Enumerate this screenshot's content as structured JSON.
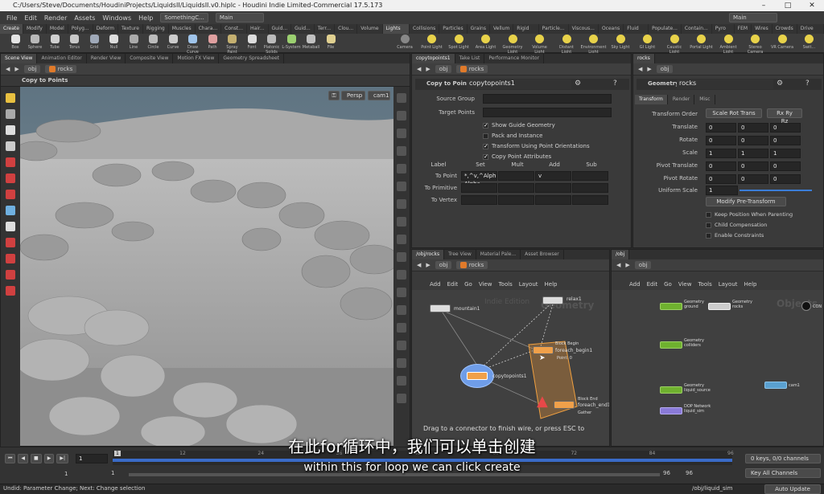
{
  "window": {
    "title": "C:/Users/Steve/Documents/HoudiniProjects/LiquidsII/LiquidsII.v0.hiplc - Houdini Indie Limited-Commercial 17.5.173"
  },
  "menu": {
    "items": [
      "File",
      "Edit",
      "Render",
      "Assets",
      "Windows",
      "Help"
    ],
    "desktop": "SomethingC...",
    "main_left": "Main",
    "main_right": "Main"
  },
  "shelf_tabs_left": [
    "Create",
    "Modify",
    "Model",
    "Polyg...",
    "Deform",
    "Texture",
    "Rigging",
    "Muscles",
    "Chara...",
    "Const...",
    "Hair...",
    "Guid...",
    "Guid...",
    "Terr...",
    "Clou...",
    "Volume"
  ],
  "shelf_tabs_right": [
    "Lights a...",
    "Collisions",
    "Particles",
    "Grains",
    "Vellum",
    "Rigid B...",
    "Particle...",
    "Viscous...",
    "Oceans",
    "Fluid C...",
    "Populate...",
    "Contain...",
    "Pyro FX",
    "FEM",
    "Wires",
    "Crowds",
    "Drive Si..."
  ],
  "shelf_tools_left": [
    "Box",
    "Sphere",
    "Tube",
    "Torus",
    "Grid",
    "Null",
    "Line",
    "Circle",
    "Curve",
    "Draw Curve",
    "Path",
    "Spray Paint",
    "Font",
    "Platonic Solids",
    "L-System",
    "Metaball",
    "File"
  ],
  "shelf_tools_right": [
    "Camera",
    "Point Light",
    "Spot Light",
    "Area Light",
    "Geometry Light",
    "Volume Light",
    "Distant Light",
    "Environment Light",
    "Sky Light",
    "GI Light",
    "Caustic Light",
    "Portal Light",
    "Ambient Light",
    "Stereo Camera",
    "VR Camera",
    "Swit..."
  ],
  "viewport": {
    "tabs": [
      "Scene View",
      "Animation Editor",
      "Render View",
      "Composite View",
      "Motion FX View",
      "Geometry Spreadsheet"
    ],
    "path": [
      "obj",
      "rocks"
    ],
    "node_label": "Copy to Points",
    "persp": "Persp",
    "cam": "cam1"
  },
  "params": {
    "tabs": [
      "copytopoints1",
      "Take List",
      "Performance Monitor"
    ],
    "path": [
      "obj",
      "rocks"
    ],
    "node_type": "Copy to Points",
    "node_name": "copytopoints1",
    "source_group_label": "Source Group",
    "target_points_label": "Target Points",
    "checkboxes": [
      {
        "label": "Show Guide Geometry",
        "checked": true
      },
      {
        "label": "Pack and Instance",
        "checked": false
      },
      {
        "label": "Transform Using Point Orientations",
        "checked": true
      },
      {
        "label": "Copy Point Attributes",
        "checked": true
      }
    ],
    "attr_headers": [
      "Label",
      "Set",
      "Mult",
      "Add",
      "Sub"
    ],
    "attr_rows": [
      {
        "label": "To Point",
        "set": "*,^v,^Alph Alpha",
        "mult": "",
        "add": "v",
        "sub": ""
      },
      {
        "label": "To Primitive",
        "set": "",
        "mult": "",
        "add": "",
        "sub": ""
      },
      {
        "label": "To Vertex",
        "set": "",
        "mult": "",
        "add": "",
        "sub": ""
      }
    ]
  },
  "geo": {
    "tabs": [
      "rocks"
    ],
    "path": [
      "obj"
    ],
    "node_type": "Geometry",
    "node_name": "rocks",
    "subtabs": [
      "Transform",
      "Render",
      "Misc"
    ],
    "transform_order": {
      "label": "Transform Order",
      "value": "Scale Rot Trans",
      "rot": "Rx Ry Rz"
    },
    "rows": [
      {
        "label": "Translate",
        "v": [
          "0",
          "0",
          "0"
        ]
      },
      {
        "label": "Rotate",
        "v": [
          "0",
          "0",
          "0"
        ]
      },
      {
        "label": "Scale",
        "v": [
          "1",
          "1",
          "1"
        ]
      },
      {
        "label": "Pivot Translate",
        "v": [
          "0",
          "0",
          "0"
        ]
      },
      {
        "label": "Pivot Rotate",
        "v": [
          "0",
          "0",
          "0"
        ]
      }
    ],
    "uniform_scale": {
      "label": "Uniform Scale",
      "value": "1"
    },
    "modify_button": "Modify Pre-Transform",
    "options": [
      "Keep Position When Parenting",
      "Child Compensation",
      "Enable Constraints"
    ]
  },
  "network_left": {
    "tabs": [
      "/obj/rocks",
      "Tree View",
      "Material Pale...",
      "Asset Browser"
    ],
    "path": [
      "obj",
      "rocks"
    ],
    "menu": [
      "Add",
      "Edit",
      "Go",
      "View",
      "Tools",
      "Layout",
      "Help"
    ],
    "watermark": "Indie Edition",
    "context": "Geometry",
    "nodes": {
      "mountain": "mountain1",
      "relax": "relax1",
      "block_begin": "Block Begin",
      "foreach_begin": "foreach_begin1",
      "point_label": "Point: 0",
      "copy": "copytopoints1",
      "block_end": "Block End",
      "foreach_end": "foreach_end1",
      "gather": "Gather"
    },
    "hint": "Drag to a connector to finish wire, or press ESC to"
  },
  "network_right": {
    "tabs": [
      "/obj"
    ],
    "path": [
      "obj"
    ],
    "menu": [
      "Add",
      "Edit",
      "Go",
      "View",
      "Tools",
      "Layout",
      "Help"
    ],
    "context": "Objects",
    "nodes": [
      {
        "type": "Geometry",
        "name": "ground"
      },
      {
        "type": "Geometry",
        "name": "rocks"
      },
      {
        "type": "Geometry",
        "name": "colliders"
      },
      {
        "type": "Geometry",
        "name": "liquid_source"
      },
      {
        "type": "DOP Network",
        "name": "liquid_sim"
      },
      {
        "type": "",
        "name": "cam1"
      }
    ],
    "con_label": "CON"
  },
  "timeline": {
    "frame": "1",
    "start": "1",
    "end": "96",
    "range_end": "96",
    "ticks": [
      "12",
      "24",
      "36",
      "48",
      "60",
      "72",
      "84",
      "96"
    ],
    "keys": "0 keys, 0/0 channels",
    "key_all": "Key All Channels",
    "auto_update": "Auto Update",
    "obj_path": "/obj/liquid_sim"
  },
  "status": {
    "text": "Undid: Parameter Change; Next: Change selection"
  },
  "subtitles": {
    "cn": "在此for循环中，我们可以单击创建",
    "en": "within this for loop we can click create"
  }
}
